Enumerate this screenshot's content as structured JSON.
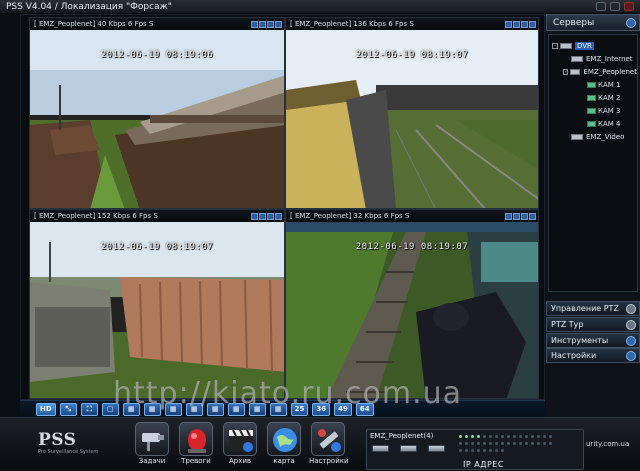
{
  "window": {
    "title": "PSS  V4.04 / Локализация \"Форсаж\""
  },
  "cameras": [
    {
      "label": "[ EMZ_Peoplenet] 40 Kbps 6 Fps S",
      "timestamp": "2012-06-19 08:19:06"
    },
    {
      "label": "[ EMZ_Peoplenet] 136 Kbps 6 Fps S",
      "timestamp": "2012-06-19 08:19:07"
    },
    {
      "label": "[ EMZ_Peoplenet] 152 Kbps 6 Fps S",
      "timestamp": "2012-06-19 08:19:07"
    },
    {
      "label": "[ EMZ_Peoplenet] 32 Kbps 6 Fps S",
      "timestamp": "2012-06-19 08:19:07"
    }
  ],
  "video_toolbar": {
    "hd_label": "HD",
    "layout_25": "25",
    "layout_36": "36",
    "layout_49": "49",
    "layout_64": "64"
  },
  "servers": {
    "header": "Серверы",
    "tree": [
      {
        "label": "DVR",
        "level": 0
      },
      {
        "label": "EMZ_Internet",
        "level": 1
      },
      {
        "label": "EMZ_Peoplenet",
        "level": 1
      },
      {
        "label": "КАМ 1",
        "level": 2
      },
      {
        "label": "КАМ 2",
        "level": 2
      },
      {
        "label": "КАМ 3",
        "level": 2
      },
      {
        "label": "КАМ 4",
        "level": 2
      },
      {
        "label": "EMZ_Video",
        "level": 1
      }
    ]
  },
  "panels": {
    "ptz_control": "Управление PTZ",
    "ptz_type": "PTZ Тур",
    "tools": "Инструменты",
    "settings": "Настройки"
  },
  "bottom": {
    "logo": "PSS",
    "logo_sub": "Pro Surveillance System",
    "tools": [
      {
        "label": "Задачи",
        "icon": "camera-task-icon"
      },
      {
        "label": "Тревоги",
        "icon": "alarm-siren-icon"
      },
      {
        "label": "Архив",
        "icon": "archive-clapper-icon"
      },
      {
        "label": "карта",
        "icon": "map-globe-icon"
      },
      {
        "label": "Настройки",
        "icon": "settings-tools-icon"
      }
    ],
    "network_panel_title": "EMZ_Peoplenet(4)",
    "ip_label": "IP АДРЕС",
    "status_right": "urity.com.ua"
  },
  "watermark": "http://kiato.ru.com.ua",
  "colors": {
    "accent": "#2f66b0",
    "background": "#0b0f14",
    "selection": "#2a60b6"
  }
}
